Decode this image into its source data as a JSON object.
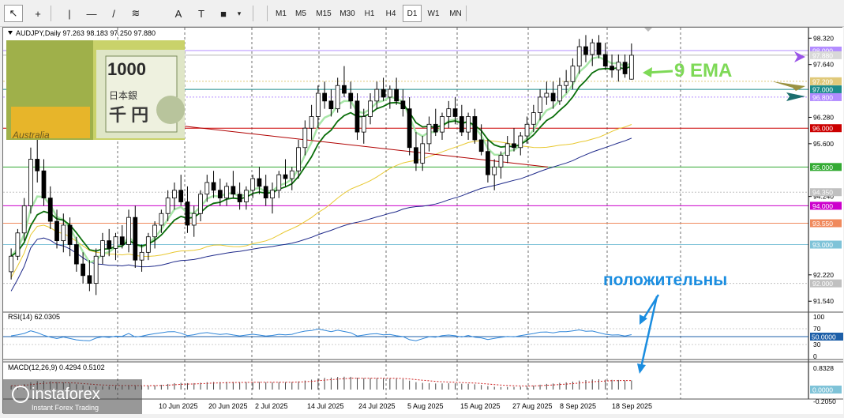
{
  "toolbar": {
    "tools": [
      {
        "name": "cursor-icon",
        "glyph": "↖"
      },
      {
        "name": "crosshair-icon",
        "glyph": "+"
      },
      {
        "name": "vertical-line-icon",
        "glyph": "|"
      },
      {
        "name": "horizontal-line-icon",
        "glyph": "—"
      },
      {
        "name": "trend-line-icon",
        "glyph": "/"
      },
      {
        "name": "fibonacci-icon",
        "glyph": "≋"
      },
      {
        "name": "text-icon",
        "glyph": "A"
      },
      {
        "name": "label-icon",
        "glyph": "T"
      },
      {
        "name": "shapes-icon",
        "glyph": "■"
      }
    ],
    "timeframes": [
      "M1",
      "M5",
      "M15",
      "M30",
      "H1",
      "H4",
      "D1",
      "W1",
      "MN"
    ],
    "active_timeframe": "D1"
  },
  "chart": {
    "symbol_line": "AUDJPY,Daily  97.263 98.183 97.250 97.880",
    "overlay_bg": "#ffffff",
    "ema_annotation": "9 EMA",
    "ema_annotation_color": "#7ed957",
    "positive_annotation": "положительны",
    "positive_annotation_color": "#1a8de0",
    "price_axis": [
      "98.320",
      "97.640",
      "96.280",
      "95.600",
      "94.240",
      "92.220",
      "91.540"
    ],
    "price_tags": [
      {
        "label": "98.000",
        "price": 98.0,
        "color": "#b38cff"
      },
      {
        "label": "97.880",
        "price": 97.88,
        "color": "#d8d8d8"
      },
      {
        "label": "97.209",
        "price": 97.209,
        "color": "#e0c97a"
      },
      {
        "label": "97.000",
        "price": 97.0,
        "color": "#1d8c8c"
      },
      {
        "label": "96.800",
        "price": 96.8,
        "color": "#b38cff"
      },
      {
        "label": "96.000",
        "price": 96.0,
        "color": "#cc0000"
      },
      {
        "label": "95.000",
        "price": 95.0,
        "color": "#33aa33"
      },
      {
        "label": "94.350",
        "price": 94.35,
        "color": "#c0c0c0"
      },
      {
        "label": "94.000",
        "price": 94.0,
        "color": "#cc00cc"
      },
      {
        "label": "93.550",
        "price": 93.55,
        "color": "#f08a5d"
      },
      {
        "label": "93.000",
        "price": 93.0,
        "color": "#7fc3d8"
      },
      {
        "label": "92.000",
        "price": 92.0,
        "color": "#c0c0c0"
      }
    ],
    "x_labels": [
      "10 Jun 2025",
      "20 Jun 2025",
      "2 Jul 2025",
      "14 Jul 2025",
      "24 Jul 2025",
      "5 Aug 2025",
      "15 Aug 2025",
      "27 Aug 2025",
      "8 Sep 2025",
      "18 Sep 2025"
    ]
  },
  "rsi": {
    "title": "RSI(14) 62.0305",
    "axis": [
      "100",
      "70",
      "30",
      "0"
    ],
    "tag": "50.0000"
  },
  "macd": {
    "title": "MACD(12,26,9) 0.4294 0.5102",
    "axis": [
      "0.8328",
      "-0.2050"
    ],
    "tag": "0.0000"
  },
  "watermark": {
    "brand": "instaforex",
    "tagline": "Instant Forex Trading"
  },
  "chart_data": {
    "type": "candlestick",
    "symbol": "AUDJPY",
    "timeframe": "Daily",
    "ohlc_last": {
      "open": 97.263,
      "high": 98.183,
      "low": 97.25,
      "close": 97.88
    },
    "ylim": [
      91.3,
      98.55
    ],
    "candles": [
      [
        92.3,
        92.9,
        92.1,
        92.7
      ],
      [
        92.7,
        93.4,
        92.6,
        93.3
      ],
      [
        93.3,
        94.2,
        93.1,
        94.0
      ],
      [
        94.0,
        95.5,
        93.8,
        95.2
      ],
      [
        95.2,
        95.8,
        94.6,
        94.9
      ],
      [
        94.9,
        95.2,
        94.0,
        94.2
      ],
      [
        94.2,
        94.5,
        93.4,
        93.6
      ],
      [
        93.6,
        93.9,
        92.9,
        93.1
      ],
      [
        93.1,
        93.8,
        92.8,
        93.5
      ],
      [
        93.5,
        93.7,
        92.7,
        93.0
      ],
      [
        93.0,
        93.2,
        92.3,
        92.5
      ],
      [
        92.5,
        92.8,
        92.0,
        92.2
      ],
      [
        92.2,
        92.6,
        91.8,
        92.0
      ],
      [
        92.0,
        92.9,
        91.7,
        92.7
      ],
      [
        92.7,
        93.3,
        92.5,
        93.1
      ],
      [
        93.1,
        93.4,
        92.7,
        92.9
      ],
      [
        92.9,
        93.3,
        92.6,
        93.2
      ],
      [
        93.2,
        93.5,
        92.9,
        93.0
      ],
      [
        93.0,
        93.9,
        92.8,
        93.7
      ],
      [
        93.7,
        94.0,
        92.4,
        92.6
      ],
      [
        92.6,
        93.0,
        92.3,
        92.8
      ],
      [
        92.8,
        93.3,
        92.6,
        93.2
      ],
      [
        93.2,
        93.6,
        92.9,
        93.5
      ],
      [
        93.5,
        93.9,
        93.3,
        93.8
      ],
      [
        93.8,
        94.4,
        93.6,
        94.2
      ],
      [
        94.2,
        94.6,
        93.9,
        94.4
      ],
      [
        94.4,
        94.8,
        94.0,
        94.1
      ],
      [
        94.1,
        94.5,
        93.3,
        93.5
      ],
      [
        93.5,
        94.0,
        93.2,
        93.8
      ],
      [
        93.8,
        94.4,
        93.6,
        94.3
      ],
      [
        94.3,
        94.8,
        94.1,
        94.6
      ],
      [
        94.6,
        94.9,
        94.2,
        94.4
      ],
      [
        94.4,
        94.7,
        94.0,
        94.2
      ],
      [
        94.2,
        94.6,
        94.0,
        94.5
      ],
      [
        94.5,
        94.9,
        94.2,
        94.3
      ],
      [
        94.3,
        94.6,
        93.9,
        94.1
      ],
      [
        94.1,
        94.5,
        93.9,
        94.4
      ],
      [
        94.4,
        94.8,
        94.2,
        94.7
      ],
      [
        94.7,
        95.0,
        94.3,
        94.5
      ],
      [
        94.5,
        94.8,
        94.0,
        94.2
      ],
      [
        94.2,
        94.6,
        93.8,
        94.4
      ],
      [
        94.4,
        94.9,
        94.2,
        94.8
      ],
      [
        94.8,
        95.2,
        94.5,
        94.7
      ],
      [
        94.7,
        95.0,
        94.4,
        94.9
      ],
      [
        94.9,
        95.7,
        94.7,
        95.5
      ],
      [
        95.5,
        96.2,
        95.3,
        96.0
      ],
      [
        96.0,
        96.6,
        95.7,
        96.3
      ],
      [
        96.3,
        97.1,
        96.0,
        96.9
      ],
      [
        96.9,
        97.2,
        96.5,
        96.7
      ],
      [
        96.7,
        97.0,
        96.3,
        96.5
      ],
      [
        96.5,
        97.3,
        96.4,
        97.1
      ],
      [
        97.1,
        97.6,
        96.8,
        96.9
      ],
      [
        96.9,
        97.2,
        96.5,
        96.7
      ],
      [
        96.7,
        96.9,
        95.7,
        95.9
      ],
      [
        95.9,
        96.5,
        95.6,
        96.3
      ],
      [
        96.3,
        96.9,
        96.1,
        96.7
      ],
      [
        96.7,
        97.2,
        96.5,
        97.0
      ],
      [
        97.0,
        97.3,
        96.7,
        96.8
      ],
      [
        96.8,
        97.1,
        96.5,
        97.0
      ],
      [
        97.0,
        97.3,
        96.6,
        96.7
      ],
      [
        96.7,
        97.0,
        96.3,
        96.5
      ],
      [
        96.5,
        96.8,
        95.3,
        95.5
      ],
      [
        95.5,
        95.9,
        94.9,
        95.1
      ],
      [
        95.1,
        95.8,
        94.9,
        95.6
      ],
      [
        95.6,
        96.3,
        95.4,
        96.1
      ],
      [
        96.1,
        96.5,
        95.8,
        95.9
      ],
      [
        95.9,
        96.4,
        95.7,
        96.3
      ],
      [
        96.3,
        96.7,
        96.0,
        96.5
      ],
      [
        96.5,
        96.8,
        96.1,
        96.3
      ],
      [
        96.3,
        96.6,
        95.8,
        95.9
      ],
      [
        95.9,
        96.4,
        95.7,
        96.3
      ],
      [
        96.3,
        96.5,
        95.6,
        95.7
      ],
      [
        95.7,
        96.1,
        95.3,
        95.4
      ],
      [
        95.4,
        95.7,
        94.6,
        94.8
      ],
      [
        94.8,
        95.2,
        94.4,
        95.0
      ],
      [
        95.0,
        95.4,
        94.7,
        95.3
      ],
      [
        95.3,
        95.8,
        95.1,
        95.6
      ],
      [
        95.6,
        96.0,
        95.4,
        95.5
      ],
      [
        95.5,
        95.9,
        95.3,
        95.8
      ],
      [
        95.8,
        96.3,
        95.6,
        96.1
      ],
      [
        96.1,
        96.6,
        95.9,
        96.4
      ],
      [
        96.4,
        97.0,
        96.2,
        96.8
      ],
      [
        96.8,
        97.2,
        96.6,
        96.9
      ],
      [
        96.9,
        97.2,
        96.5,
        96.7
      ],
      [
        96.7,
        97.3,
        96.6,
        97.1
      ],
      [
        97.1,
        97.5,
        96.9,
        97.2
      ],
      [
        97.2,
        97.8,
        97.0,
        97.6
      ],
      [
        97.6,
        98.3,
        97.4,
        98.1
      ],
      [
        98.1,
        98.4,
        97.7,
        97.9
      ],
      [
        97.9,
        98.3,
        97.6,
        98.2
      ],
      [
        98.2,
        98.4,
        97.8,
        97.9
      ],
      [
        97.9,
        98.2,
        97.5,
        97.6
      ],
      [
        97.6,
        97.9,
        97.3,
        97.5
      ],
      [
        97.5,
        97.9,
        97.2,
        97.7
      ],
      [
        97.7,
        97.9,
        97.3,
        97.4
      ],
      [
        97.263,
        98.183,
        97.25,
        97.88
      ]
    ],
    "series": [
      {
        "name": "9 EMA"
      }
    ]
  }
}
